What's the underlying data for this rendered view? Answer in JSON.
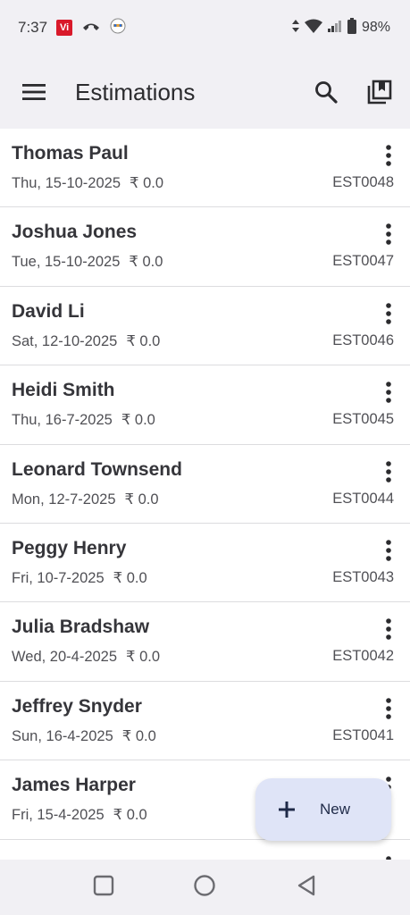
{
  "status": {
    "time": "7:37",
    "carrier_badge": "Vi",
    "battery": "98%"
  },
  "app_bar": {
    "title": "Estimations"
  },
  "estimations": [
    {
      "name": "Thomas Paul",
      "date": "Thu, 15-10-2025",
      "amount": "₹ 0.0",
      "id": "EST0048"
    },
    {
      "name": "Joshua Jones",
      "date": "Tue, 15-10-2025",
      "amount": "₹ 0.0",
      "id": "EST0047"
    },
    {
      "name": "David Li",
      "date": "Sat, 12-10-2025",
      "amount": "₹ 0.0",
      "id": "EST0046"
    },
    {
      "name": "Heidi Smith",
      "date": "Thu, 16-7-2025",
      "amount": "₹ 0.0",
      "id": "EST0045"
    },
    {
      "name": "Leonard Townsend",
      "date": "Mon, 12-7-2025",
      "amount": "₹ 0.0",
      "id": "EST0044"
    },
    {
      "name": "Peggy Henry",
      "date": "Fri, 10-7-2025",
      "amount": "₹ 0.0",
      "id": "EST0043"
    },
    {
      "name": "Julia Bradshaw",
      "date": "Wed, 20-4-2025",
      "amount": "₹ 0.0",
      "id": "EST0042"
    },
    {
      "name": "Jeffrey Snyder",
      "date": "Sun, 16-4-2025",
      "amount": "₹ 0.0",
      "id": "EST0041"
    },
    {
      "name": "James Harper",
      "date": "Fri, 15-4-2025",
      "amount": "₹ 0.0",
      "id": ""
    }
  ],
  "fab": {
    "label": "New"
  },
  "colors": {
    "background": "#f1f0f4",
    "list_background": "#ffffff",
    "fab_background": "#dfe4f7"
  }
}
